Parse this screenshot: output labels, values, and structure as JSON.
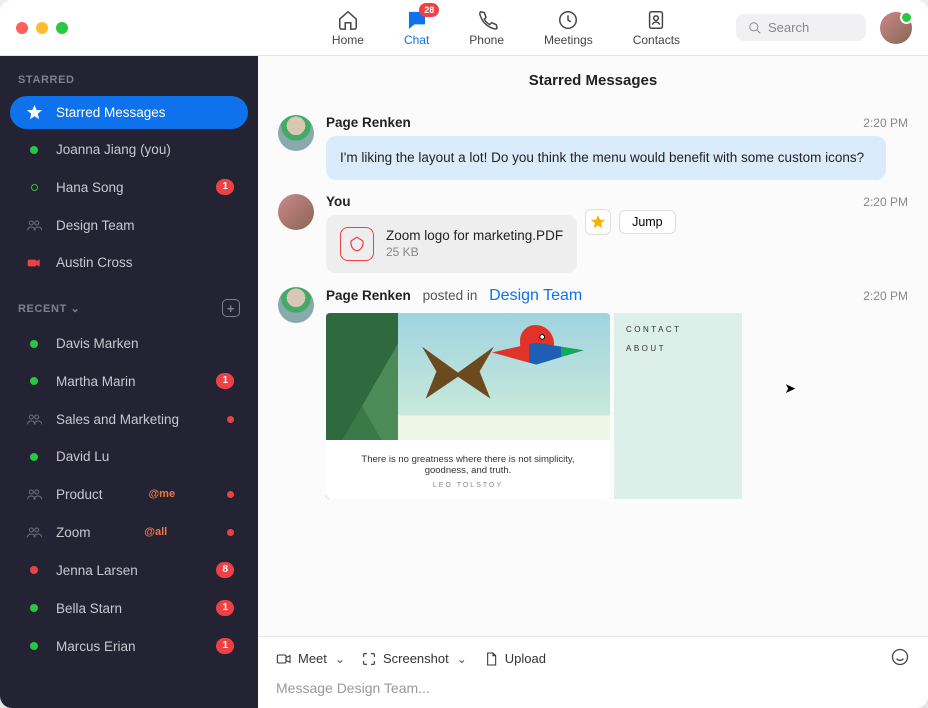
{
  "nav": {
    "home": "Home",
    "chat": "Chat",
    "chat_badge": "28",
    "phone": "Phone",
    "meetings": "Meetings",
    "contacts": "Contacts"
  },
  "search": {
    "placeholder": "Search"
  },
  "sidebar": {
    "starred_label": "STARRED",
    "recent_label": "RECENT",
    "starred": [
      {
        "label": "Starred Messages",
        "selected": true,
        "icon": "star"
      },
      {
        "label": "Joanna Jiang (you)",
        "presence": "green"
      },
      {
        "label": "Hana Song",
        "presence": "idle",
        "badge": "1"
      },
      {
        "label": "Design Team",
        "icon": "team"
      },
      {
        "label": "Austin Cross",
        "presence": "red-cam"
      }
    ],
    "recent": [
      {
        "label": "Davis Marken",
        "presence": "green"
      },
      {
        "label": "Martha Marin",
        "presence": "green",
        "badge": "1"
      },
      {
        "label": "Sales and Marketing",
        "icon": "team",
        "dot": true
      },
      {
        "label": "David Lu",
        "presence": "green"
      },
      {
        "label": "Product",
        "icon": "team",
        "mention": "@me",
        "dot": true
      },
      {
        "label": "Zoom",
        "icon": "team",
        "mention": "@all",
        "dot": true
      },
      {
        "label": "Jenna Larsen",
        "presence": "red",
        "badge": "8"
      },
      {
        "label": "Bella Starn",
        "presence": "green",
        "badge": "1"
      },
      {
        "label": "Marcus Erian",
        "presence": "green",
        "badge": "1"
      }
    ]
  },
  "main": {
    "title": "Starred Messages",
    "messages": [
      {
        "sender": "Page Renken",
        "time": "2:20 PM",
        "text": "I'm liking the layout a lot! Do you think the menu would benefit with some custom icons?"
      },
      {
        "sender": "You",
        "time": "2:20 PM",
        "file": {
          "name": "Zoom logo for marketing.PDF",
          "size": "25 KB"
        },
        "jump_label": "Jump"
      },
      {
        "sender": "Page Renken",
        "posted_in_text": "posted in",
        "channel": "Design Team",
        "time": "2:20 PM",
        "image_quote": "There is no greatness where there is not simplicity, goodness, and truth.",
        "image_author": "LEO TOLSTOY",
        "side_links": [
          "CONTACT",
          "ABOUT"
        ]
      }
    ]
  },
  "composer": {
    "meet": "Meet",
    "screenshot": "Screenshot",
    "upload": "Upload",
    "placeholder": "Message Design Team..."
  }
}
